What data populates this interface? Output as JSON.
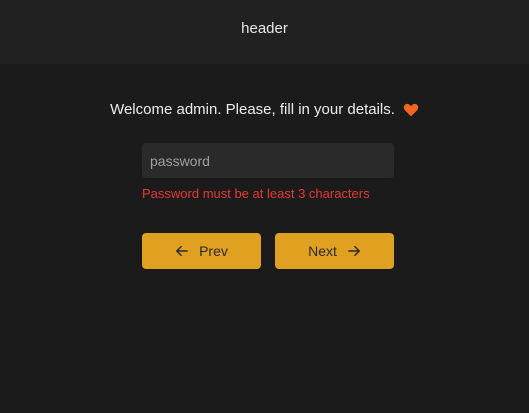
{
  "header": {
    "title": "header"
  },
  "form": {
    "welcome_text": "Welcome admin. Please, fill in your details.",
    "heart_icon": "heart-icon",
    "heart_color": "#f26522",
    "password": {
      "value": "",
      "placeholder": "password"
    },
    "error_text": "Password must be at least 3 characters",
    "error_color": "#e53935"
  },
  "buttons": {
    "prev_label": "Prev",
    "next_label": "Next",
    "accent_color": "#e0a020"
  }
}
